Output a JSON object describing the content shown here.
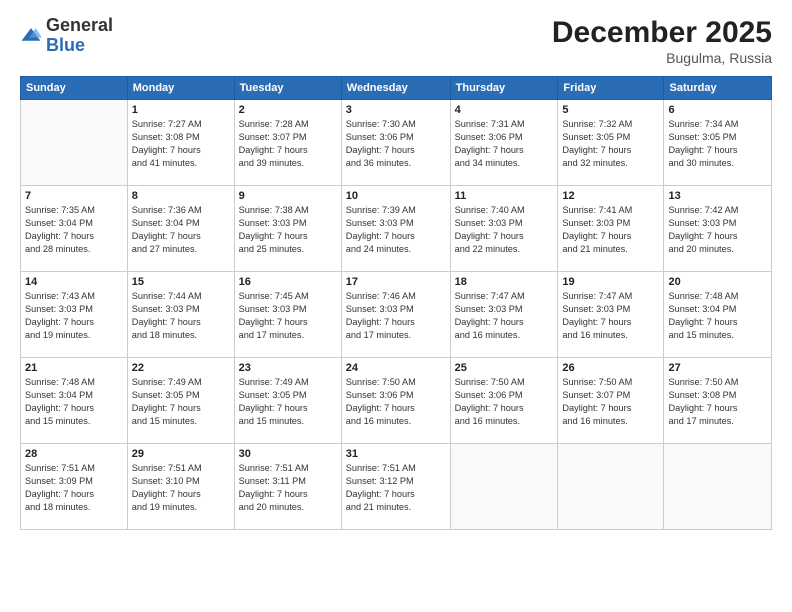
{
  "logo": {
    "general": "General",
    "blue": "Blue"
  },
  "title": {
    "month": "December 2025",
    "location": "Bugulma, Russia"
  },
  "weekdays": [
    "Sunday",
    "Monday",
    "Tuesday",
    "Wednesday",
    "Thursday",
    "Friday",
    "Saturday"
  ],
  "weeks": [
    [
      {
        "day": "",
        "info": ""
      },
      {
        "day": "1",
        "info": "Sunrise: 7:27 AM\nSunset: 3:08 PM\nDaylight: 7 hours\nand 41 minutes."
      },
      {
        "day": "2",
        "info": "Sunrise: 7:28 AM\nSunset: 3:07 PM\nDaylight: 7 hours\nand 39 minutes."
      },
      {
        "day": "3",
        "info": "Sunrise: 7:30 AM\nSunset: 3:06 PM\nDaylight: 7 hours\nand 36 minutes."
      },
      {
        "day": "4",
        "info": "Sunrise: 7:31 AM\nSunset: 3:06 PM\nDaylight: 7 hours\nand 34 minutes."
      },
      {
        "day": "5",
        "info": "Sunrise: 7:32 AM\nSunset: 3:05 PM\nDaylight: 7 hours\nand 32 minutes."
      },
      {
        "day": "6",
        "info": "Sunrise: 7:34 AM\nSunset: 3:05 PM\nDaylight: 7 hours\nand 30 minutes."
      }
    ],
    [
      {
        "day": "7",
        "info": "Sunrise: 7:35 AM\nSunset: 3:04 PM\nDaylight: 7 hours\nand 28 minutes."
      },
      {
        "day": "8",
        "info": "Sunrise: 7:36 AM\nSunset: 3:04 PM\nDaylight: 7 hours\nand 27 minutes."
      },
      {
        "day": "9",
        "info": "Sunrise: 7:38 AM\nSunset: 3:03 PM\nDaylight: 7 hours\nand 25 minutes."
      },
      {
        "day": "10",
        "info": "Sunrise: 7:39 AM\nSunset: 3:03 PM\nDaylight: 7 hours\nand 24 minutes."
      },
      {
        "day": "11",
        "info": "Sunrise: 7:40 AM\nSunset: 3:03 PM\nDaylight: 7 hours\nand 22 minutes."
      },
      {
        "day": "12",
        "info": "Sunrise: 7:41 AM\nSunset: 3:03 PM\nDaylight: 7 hours\nand 21 minutes."
      },
      {
        "day": "13",
        "info": "Sunrise: 7:42 AM\nSunset: 3:03 PM\nDaylight: 7 hours\nand 20 minutes."
      }
    ],
    [
      {
        "day": "14",
        "info": "Sunrise: 7:43 AM\nSunset: 3:03 PM\nDaylight: 7 hours\nand 19 minutes."
      },
      {
        "day": "15",
        "info": "Sunrise: 7:44 AM\nSunset: 3:03 PM\nDaylight: 7 hours\nand 18 minutes."
      },
      {
        "day": "16",
        "info": "Sunrise: 7:45 AM\nSunset: 3:03 PM\nDaylight: 7 hours\nand 17 minutes."
      },
      {
        "day": "17",
        "info": "Sunrise: 7:46 AM\nSunset: 3:03 PM\nDaylight: 7 hours\nand 17 minutes."
      },
      {
        "day": "18",
        "info": "Sunrise: 7:47 AM\nSunset: 3:03 PM\nDaylight: 7 hours\nand 16 minutes."
      },
      {
        "day": "19",
        "info": "Sunrise: 7:47 AM\nSunset: 3:03 PM\nDaylight: 7 hours\nand 16 minutes."
      },
      {
        "day": "20",
        "info": "Sunrise: 7:48 AM\nSunset: 3:04 PM\nDaylight: 7 hours\nand 15 minutes."
      }
    ],
    [
      {
        "day": "21",
        "info": "Sunrise: 7:48 AM\nSunset: 3:04 PM\nDaylight: 7 hours\nand 15 minutes."
      },
      {
        "day": "22",
        "info": "Sunrise: 7:49 AM\nSunset: 3:05 PM\nDaylight: 7 hours\nand 15 minutes."
      },
      {
        "day": "23",
        "info": "Sunrise: 7:49 AM\nSunset: 3:05 PM\nDaylight: 7 hours\nand 15 minutes."
      },
      {
        "day": "24",
        "info": "Sunrise: 7:50 AM\nSunset: 3:06 PM\nDaylight: 7 hours\nand 16 minutes."
      },
      {
        "day": "25",
        "info": "Sunrise: 7:50 AM\nSunset: 3:06 PM\nDaylight: 7 hours\nand 16 minutes."
      },
      {
        "day": "26",
        "info": "Sunrise: 7:50 AM\nSunset: 3:07 PM\nDaylight: 7 hours\nand 16 minutes."
      },
      {
        "day": "27",
        "info": "Sunrise: 7:50 AM\nSunset: 3:08 PM\nDaylight: 7 hours\nand 17 minutes."
      }
    ],
    [
      {
        "day": "28",
        "info": "Sunrise: 7:51 AM\nSunset: 3:09 PM\nDaylight: 7 hours\nand 18 minutes."
      },
      {
        "day": "29",
        "info": "Sunrise: 7:51 AM\nSunset: 3:10 PM\nDaylight: 7 hours\nand 19 minutes."
      },
      {
        "day": "30",
        "info": "Sunrise: 7:51 AM\nSunset: 3:11 PM\nDaylight: 7 hours\nand 20 minutes."
      },
      {
        "day": "31",
        "info": "Sunrise: 7:51 AM\nSunset: 3:12 PM\nDaylight: 7 hours\nand 21 minutes."
      },
      {
        "day": "",
        "info": ""
      },
      {
        "day": "",
        "info": ""
      },
      {
        "day": "",
        "info": ""
      }
    ]
  ]
}
